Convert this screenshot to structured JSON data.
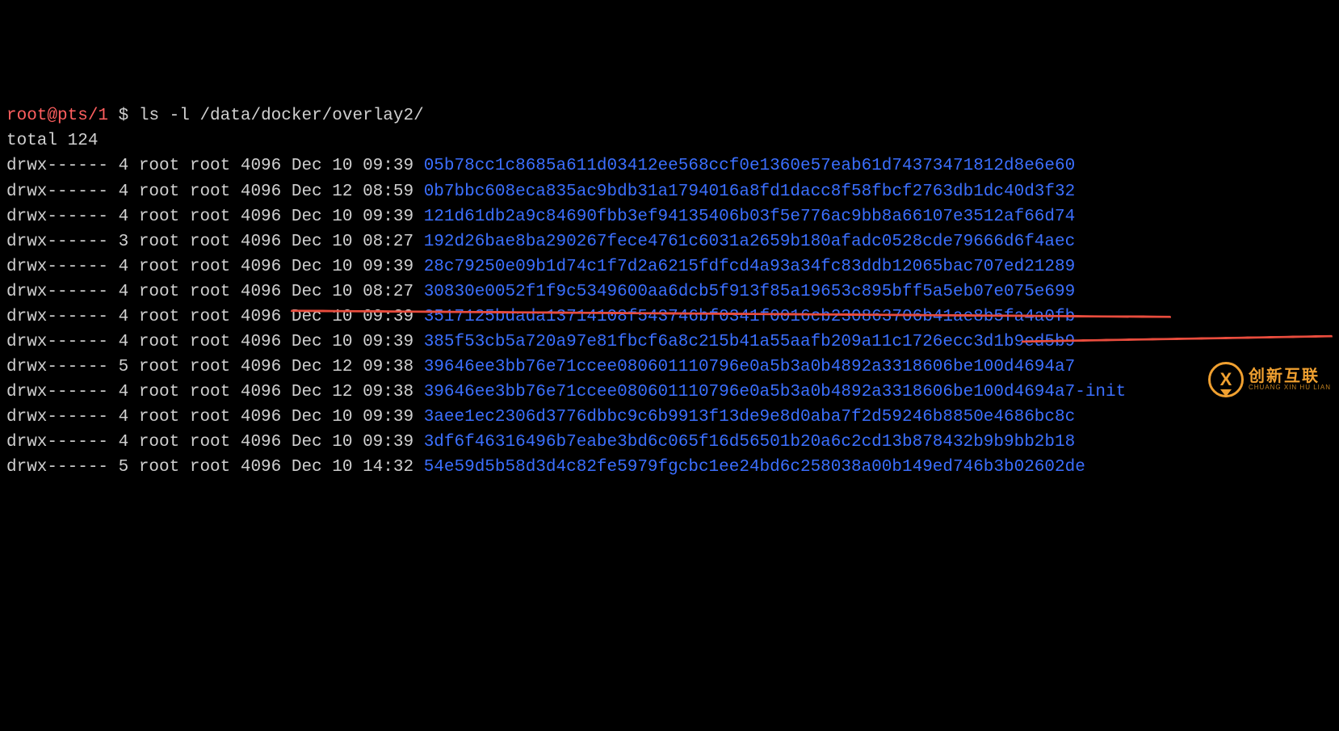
{
  "prompt": {
    "user_host": "root@pts/1",
    "separator": " $ ",
    "command": "ls -l /data/docker/overlay2/"
  },
  "total_line": "total 124",
  "rows": [
    {
      "perm": "drwx------",
      "links": "4",
      "owner": "root",
      "group": "root",
      "size": "4096",
      "month": "Dec",
      "day": "10",
      "time": "09:39",
      "name": "05b78cc1c8685a611d03412ee568ccf0e1360e57eab61d74373471812d8e6e60"
    },
    {
      "perm": "drwx------",
      "links": "4",
      "owner": "root",
      "group": "root",
      "size": "4096",
      "month": "Dec",
      "day": "12",
      "time": "08:59",
      "name": "0b7bbc608eca835ac9bdb31a1794016a8fd1dacc8f58fbcf2763db1dc40d3f32"
    },
    {
      "perm": "drwx------",
      "links": "4",
      "owner": "root",
      "group": "root",
      "size": "4096",
      "month": "Dec",
      "day": "10",
      "time": "09:39",
      "name": "121d61db2a9c84690fbb3ef94135406b03f5e776ac9bb8a66107e3512af66d74"
    },
    {
      "perm": "drwx------",
      "links": "3",
      "owner": "root",
      "group": "root",
      "size": "4096",
      "month": "Dec",
      "day": "10",
      "time": "08:27",
      "name": "192d26bae8ba290267fece4761c6031a2659b180afadc0528cde79666d6f4aec"
    },
    {
      "perm": "drwx------",
      "links": "4",
      "owner": "root",
      "group": "root",
      "size": "4096",
      "month": "Dec",
      "day": "10",
      "time": "09:39",
      "name": "28c79250e09b1d74c1f7d2a6215fdfcd4a93a34fc83ddb12065bac707ed21289"
    },
    {
      "perm": "drwx------",
      "links": "4",
      "owner": "root",
      "group": "root",
      "size": "4096",
      "month": "Dec",
      "day": "10",
      "time": "08:27",
      "name": "30830e0052f1f9c5349600aa6dcb5f913f85a19653c895bff5a5eb07e075e699"
    },
    {
      "perm": "drwx------",
      "links": "4",
      "owner": "root",
      "group": "root",
      "size": "4096",
      "month": "Dec",
      "day": "10",
      "time": "09:39",
      "name": "3517125bdada13714108f543746bf0341f0016cb230863706b41ae8b5fa4a0fb"
    },
    {
      "perm": "drwx------",
      "links": "4",
      "owner": "root",
      "group": "root",
      "size": "4096",
      "month": "Dec",
      "day": "10",
      "time": "09:39",
      "name": "385f53cb5a720a97e81fbcf6a8c215b41a55aafb209a11c1726ecc3d1b9ed5b9"
    },
    {
      "perm": "drwx------",
      "links": "5",
      "owner": "root",
      "group": "root",
      "size": "4096",
      "month": "Dec",
      "day": "12",
      "time": "09:38",
      "name": "39646ee3bb76e71ccee080601110796e0a5b3a0b4892a3318606be100d4694a7"
    },
    {
      "perm": "drwx------",
      "links": "4",
      "owner": "root",
      "group": "root",
      "size": "4096",
      "month": "Dec",
      "day": "12",
      "time": "09:38",
      "name": "39646ee3bb76e71ccee080601110796e0a5b3a0b4892a3318606be100d4694a7-init"
    },
    {
      "perm": "drwx------",
      "links": "4",
      "owner": "root",
      "group": "root",
      "size": "4096",
      "month": "Dec",
      "day": "10",
      "time": "09:39",
      "name": "3aee1ec2306d3776dbbc9c6b9913f13de9e8d0aba7f2d59246b8850e4686bc8c"
    },
    {
      "perm": "drwx------",
      "links": "4",
      "owner": "root",
      "group": "root",
      "size": "4096",
      "month": "Dec",
      "day": "10",
      "time": "09:39",
      "name": "3df6f46316496b7eabe3bd6c065f16d56501b20a6c2cd13b878432b9b9bb2b18"
    },
    {
      "perm": "drwx------",
      "links": "5",
      "owner": "root",
      "group": "root",
      "size": "4096",
      "month": "Dec",
      "day": "10",
      "time": "14:32",
      "name": "54e59d5b58d3d4c82fe5979fgcbc1ee24bd6c258038a00b149ed746b3b02602de"
    }
  ],
  "watermark": {
    "cn": "创新互联",
    "en": "CHUANG XIN HU LIAN"
  }
}
